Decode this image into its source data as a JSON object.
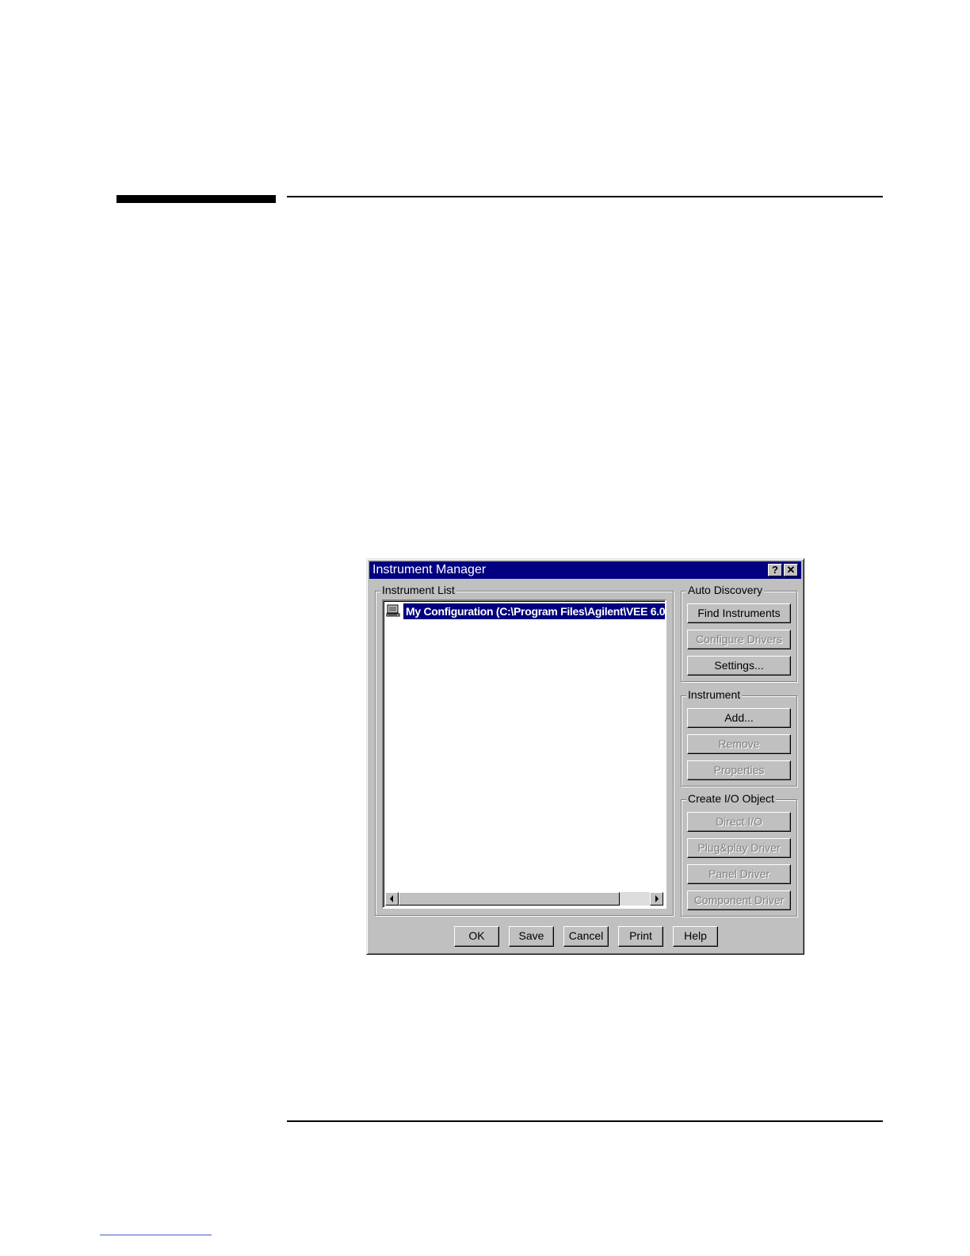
{
  "dialog": {
    "title": "Instrument Manager",
    "help_glyph": "?",
    "close_glyph": "✕",
    "instrument_list": {
      "label": "Instrument List",
      "items": [
        {
          "icon": "computer-icon",
          "label": "My Configuration (C:\\Program Files\\Agilent\\VEE 6.0"
        }
      ]
    },
    "auto_discovery": {
      "label": "Auto Discovery",
      "find_instruments": "Find Instruments",
      "configure_drivers": "Configure Drivers",
      "settings": "Settings..."
    },
    "instrument": {
      "label": "Instrument",
      "add": "Add...",
      "remove": "Remove",
      "properties": "Properties"
    },
    "create_io": {
      "label": "Create I/O Object",
      "direct_io": "Direct I/O",
      "plug_play": "Plug&play Driver",
      "panel_driver": "Panel Driver",
      "component_driver": "Component Driver"
    },
    "buttons": {
      "ok": "OK",
      "save": "Save",
      "cancel": "Cancel",
      "print": "Print",
      "help": "Help"
    }
  }
}
